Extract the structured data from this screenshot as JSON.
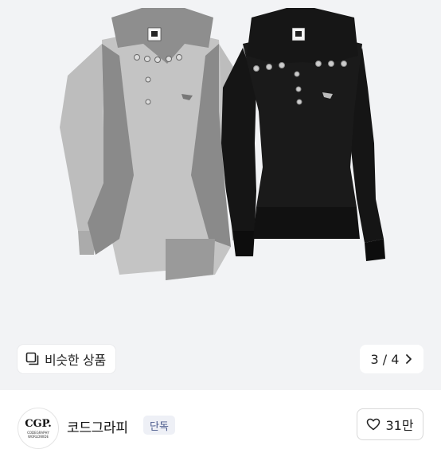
{
  "gallery": {
    "similar_label": "비슷한 상품",
    "similar_icon": "similar-items-icon",
    "page_current": "3",
    "page_separator": "/",
    "page_total": "4",
    "next_icon": "chevron-right-icon"
  },
  "brand": {
    "logo_text": "CGP.",
    "logo_sub": "CODEGRAPHY WORLDWIDE",
    "name": "코드그라피",
    "badge": "단독"
  },
  "like": {
    "icon": "heart-outline-icon",
    "count": "31만"
  },
  "colors": {
    "background": "#f2f3f5",
    "shirt_light": "#bcbcbc",
    "shirt_dark": "#838383",
    "shirt_black": "#151515"
  }
}
